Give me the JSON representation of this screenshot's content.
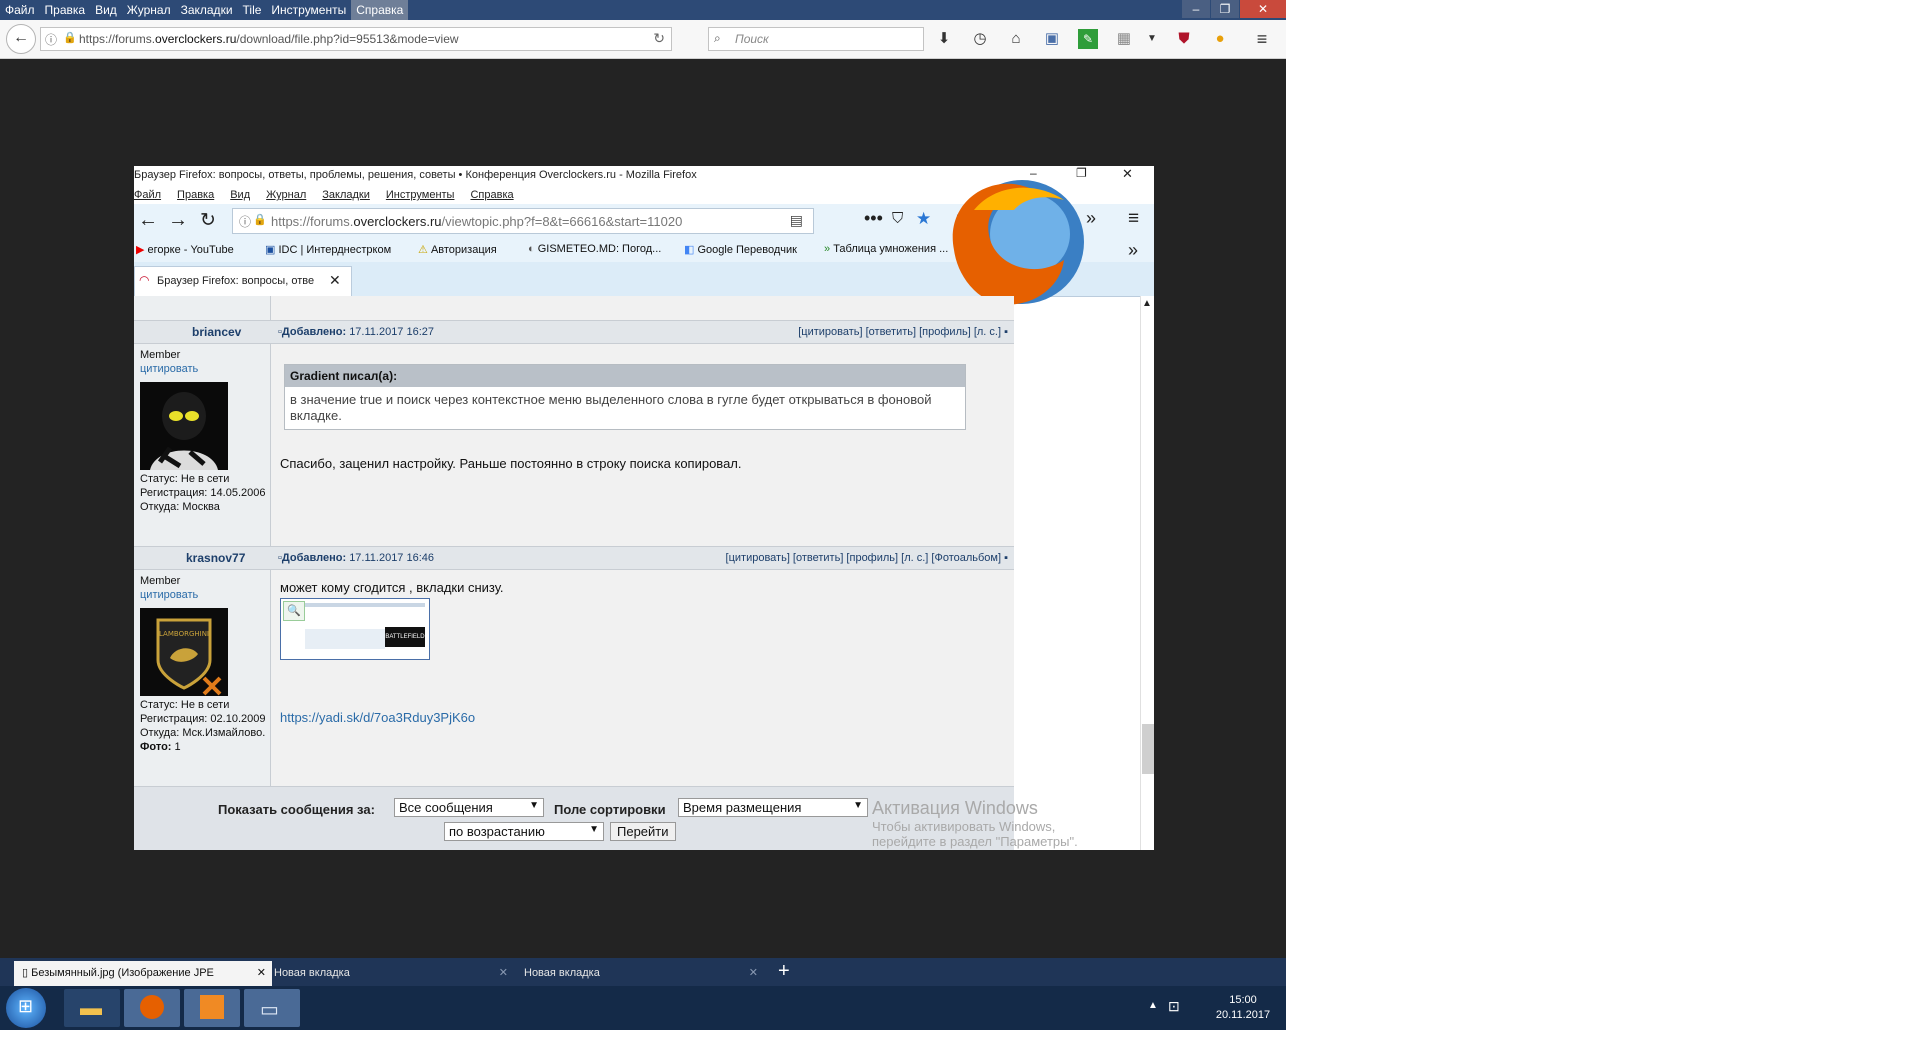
{
  "outer": {
    "menu": [
      "Файл",
      "Правка",
      "Вид",
      "Журнал",
      "Закладки",
      "Tile",
      "Инструменты",
      "Справка"
    ],
    "url_prefix": "https://forums.",
    "url_domain": "overclockers.ru",
    "url_path": "/download/file.php?id=95513&mode=view",
    "search_placeholder": "Поиск"
  },
  "inner": {
    "window_title": "Браузер Firefox: вопросы, ответы, проблемы, решения, советы • Конференция Overclockers.ru - Mozilla Firefox",
    "menu": [
      "Файл",
      "Правка",
      "Вид",
      "Журнал",
      "Закладки",
      "Инструменты",
      "Справка"
    ],
    "url_prefix": "https://forums.",
    "url_domain": "overclockers.ru",
    "url_path": "/viewtopic.php?f=8&t=66616&start=11020",
    "bookmarks": [
      "егорке - YouTube",
      "IDC | Интерднестрком",
      "Авторизация",
      "GISMETEO.MD: Погод...",
      "Google Переводчик",
      "Таблица умножения ..."
    ],
    "tab_label": "Браузер Firefox: вопросы, отве"
  },
  "posts": [
    {
      "nick": "briancev",
      "added_label": "Добавлено:",
      "date": "17.11.2017 16:27",
      "links": "[цитировать] [ответить] [профиль] [л. с.]",
      "rank": "Member",
      "quote_link": "цитировать",
      "status": "Статус: Не в сети",
      "reg": "Регистрация: 14.05.2006",
      "from": "Откуда: Москва",
      "quote_author": "Gradient писал(а):",
      "quote_text": "в значение true и поиск через контекстное меню выделенного слова в гугле будет открываться в фоновой вкладке.",
      "body": "Спасибо, заценил настройку. Раньше постоянно в строку поиска копировал."
    },
    {
      "nick": "krasnov77",
      "added_label": "Добавлено:",
      "date": "17.11.2017 16:46",
      "links": "[цитировать] [ответить] [профиль] [л. с.] [Фотоальбом]",
      "rank": "Member",
      "quote_link": "цитировать",
      "avatar_text": "LAMBORGHINI",
      "status": "Статус: Не в сети",
      "reg": "Регистрация: 02.10.2009",
      "from": "Откуда: Мск.Измайлово.",
      "photos_label": "Фото:",
      "photos_value": "1",
      "body": "может кому сгодится , вкладки снизу.",
      "thumb_text": "BATTLEFIELD",
      "link": "https://yadi.sk/d/7oa3Rduy3PjK6o"
    }
  ],
  "sort": {
    "show_label": "Показать сообщения за:",
    "show_value": "Все сообщения",
    "sort_label": "Поле сортировки",
    "sort_value": "Время размещения",
    "order_value": "по возрастанию",
    "go_button": "Перейти"
  },
  "watermark": {
    "line1": "Активация Windows",
    "line2": "Чтобы активировать Windows,",
    "line3": "перейдите в раздел \"Параметры\"."
  },
  "bottom_tabs": [
    "Безымянный.jpg (Изображение JPE",
    "Новая вкладка",
    "Новая вкладка"
  ],
  "clock": {
    "time": "15:00",
    "date": "20.11.2017"
  }
}
